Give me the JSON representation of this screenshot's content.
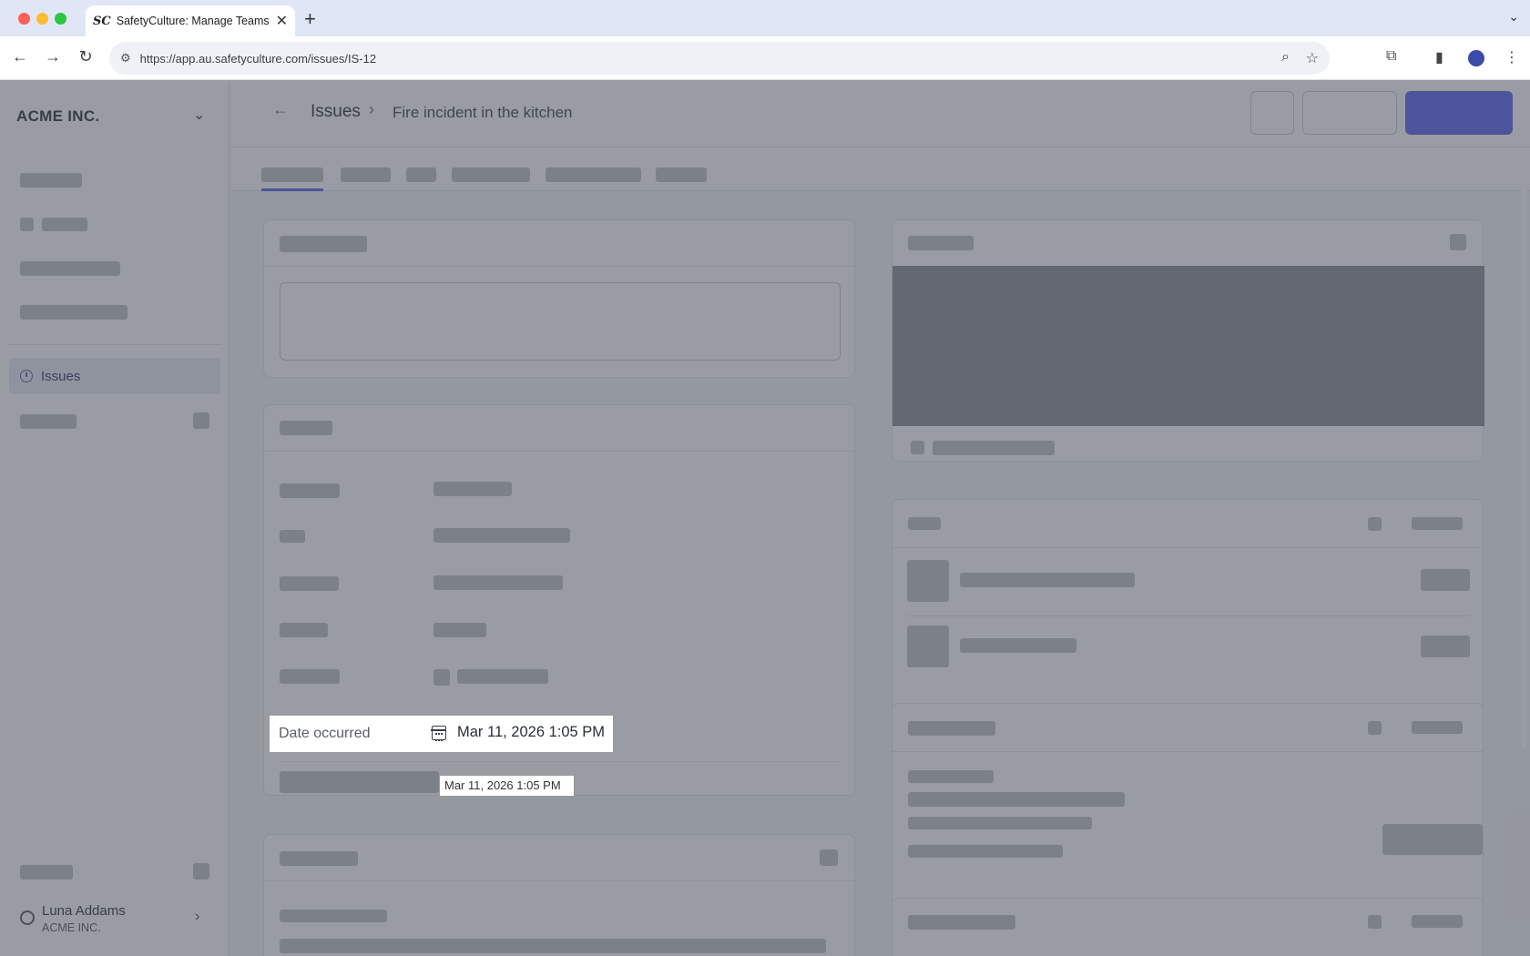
{
  "browser": {
    "tab_title": "SafetyCulture: Manage Teams and...",
    "tab_favicon": "SC",
    "url": "https://app.au.safetyculture.com/issues/IS-12"
  },
  "sidebar": {
    "org_name": "ACME INC.",
    "active_item": "Issues",
    "user_name": "Luna Addams",
    "user_org": "ACME INC."
  },
  "header": {
    "breadcrumb_parent": "Issues",
    "breadcrumb_current": "Fire incident in the kitchen"
  },
  "highlight": {
    "field_label": "Date occurred",
    "field_value": "Mar 11, 2026 1:05 PM",
    "tooltip_text": "Mar 11, 2026 1:05 PM"
  },
  "colors": {
    "accent": "#5a5ff0",
    "overlay": "#464a56"
  }
}
